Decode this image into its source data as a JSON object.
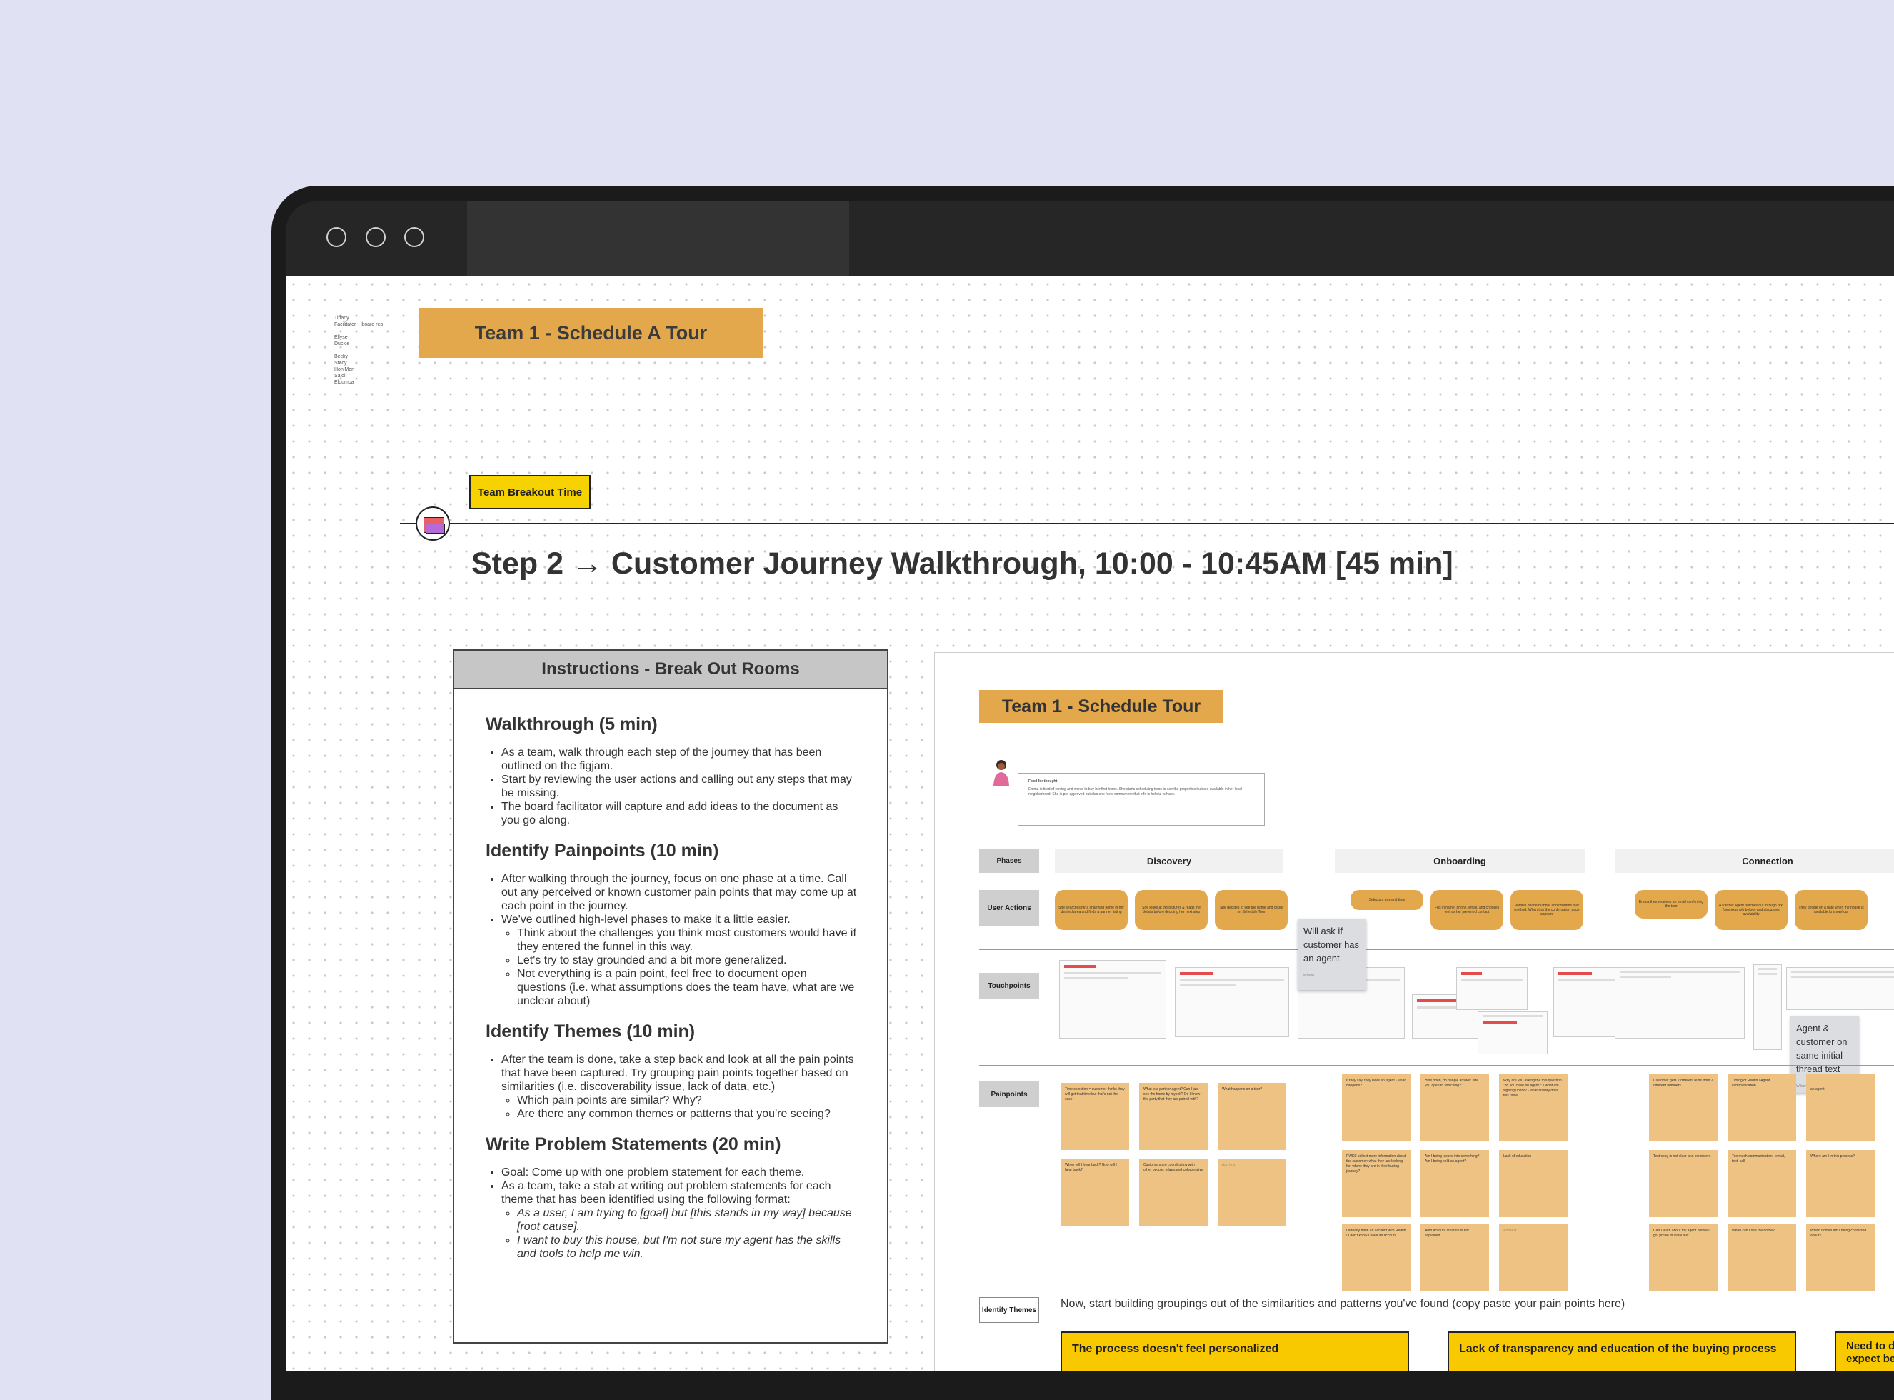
{
  "window": {
    "controls": [
      "window-dot-1",
      "window-dot-2",
      "window-dot-3"
    ]
  },
  "canvas": {
    "facilitator_names": "Tiffany\nFacilitator + board rep\n\nEllyse\nDuckie\n\nBecky\nStacy\nHoniMan\nSaidi\nEloumpa",
    "team_title": "Team 1 - Schedule A Tour",
    "breakout_tag": "Team Breakout Time",
    "step_title": "Step 2 → Customer Journey Walkthrough, 10:00 - 10:45AM [45 min]"
  },
  "instructions": {
    "header": "Instructions - Break Out Rooms",
    "sections": [
      {
        "title": "Walkthrough (5 min)",
        "items": [
          "As a team, walk through each step of the journey that has been outlined on the figjam.",
          "Start by reviewing the user actions and calling out any steps that may be missing.",
          "The board facilitator will capture and add ideas to the document as you go along."
        ]
      },
      {
        "title": "Identify Painpoints (10 min)",
        "items": [
          "After walking through the journey, focus on one phase at a time. Call out any perceived or known customer pain points that may come up at each point in the journey.",
          "We've outlined high-level phases to make it a little easier."
        ],
        "subitems": [
          "Think about the challenges you think most customers would have if they entered the funnel in this way.",
          "Let's try to stay grounded and a bit more generalized.",
          "Not everything is a pain point, feel free to document open questions (i.e. what assumptions does the team have, what are we unclear about)"
        ]
      },
      {
        "title": "Identify Themes (10 min)",
        "items": [
          "After the team is done, take a step back and look at all the pain points that have been captured. Try grouping pain points together based on similarities (i.e. discoverability issue, lack of data, etc.)"
        ],
        "subitems": [
          "Which pain points are similar? Why?",
          "Are there any common themes or patterns that you're seeing?"
        ]
      },
      {
        "title": "Write Problem Statements (20 min)",
        "items": [
          "Goal: Come up with one problem statement for each theme.",
          "As a team, take a stab at writing out problem statements for each theme that has been identified using the following format:"
        ],
        "subitems": [
          "As a user, I am trying to [goal] but [this stands in my way] because [root cause].",
          "I want to buy this house, but I'm not sure my agent has the skills and tools to help me win."
        ]
      }
    ]
  },
  "board": {
    "title": "Team 1 - Schedule Tour",
    "thought_title": "Food for thought",
    "thought_text": "Emma is tired of renting and wants to buy her first home. She starts scheduling tours to see the properties that are available in her local neighborhood. She is pre-approved but also she feels somewhere that info is helpful to have.",
    "row_labels": {
      "phases": "Phases",
      "user_actions": "User Actions",
      "touchpoints": "Touchpoints",
      "painpoints": "Painpoints",
      "themes": "Identify Themes"
    },
    "phases": [
      "Discovery",
      "Onboarding",
      "Connection"
    ],
    "user_actions": [
      "She searches for a charming home in her desired area and finds a partner listing",
      "She looks at the pictures & reads the details before deciding her next step",
      "She decides to see the home and clicks on Schedule Tour",
      "Selects a day and time",
      "Fills in name, phone, email, and chooses text as her preferred contact",
      "Verifies phone number and confirms tour method. When this the confirmation page appears",
      "Emma then receives an email confirming the tour",
      "A Partner Agent reaches out through text (see example below) and discusses availability",
      "They decide on a date when the house is available to show/tour"
    ],
    "grey_notes": [
      {
        "text": "Will ask if customer has an agent",
        "author": "Wilson"
      },
      {
        "text": "Agent & customer on same initial thread text",
        "author": "Wilson"
      }
    ],
    "painpoints": [
      "Time selection = customer thinks they will get that time but that's not the case",
      "What is a partner agent? Can I just see the home by myself? Do I know the party that they are paired with?",
      "What happens on a tour?",
      "If they say, they have an agent - what happens?",
      "How often, do people answer \"are you open to switching?\"",
      "Why are you asking the this question \"do you have an agent?\" / what am I signing up for? - what anxiety does this raise",
      "Customer gets 2 different texts from 2 different numbers",
      "Timing of Redfin / Agent communication",
      "an agent",
      "When will I hear back? How will I hear back?",
      "Customers are coordinating with other people, inlaws and collaborative",
      "Add text",
      "PWKE collect more information about the customer: what they are looking for, where they are in their buying journey?",
      "Am I being locked into something? Am I being sold an agent?",
      "Lack of education",
      "Text copy is not clear and consistent",
      "Too much communication - email, text, call",
      "Where am I in this process?",
      "I already have an account with Redfin / I don't know I have an account",
      "Auto account creation is not explained",
      "Add text",
      "Can I learn about my agent before I go, profile in initial text",
      "When can I see the home?",
      "Which homes am I being contacted about?"
    ],
    "themes_instruction": "Now, start building groupings out of the similarities and patterns you've found (copy paste your pain points here)",
    "themes": [
      "The process doesn't feel personalized",
      "Lack of transparency and education of the buying process",
      "Need to d expect be"
    ]
  },
  "colors": {
    "background": "#e1e1f4",
    "orange": "#e3a84b",
    "sticky": "#eec283",
    "yellow": "#f9c900"
  }
}
